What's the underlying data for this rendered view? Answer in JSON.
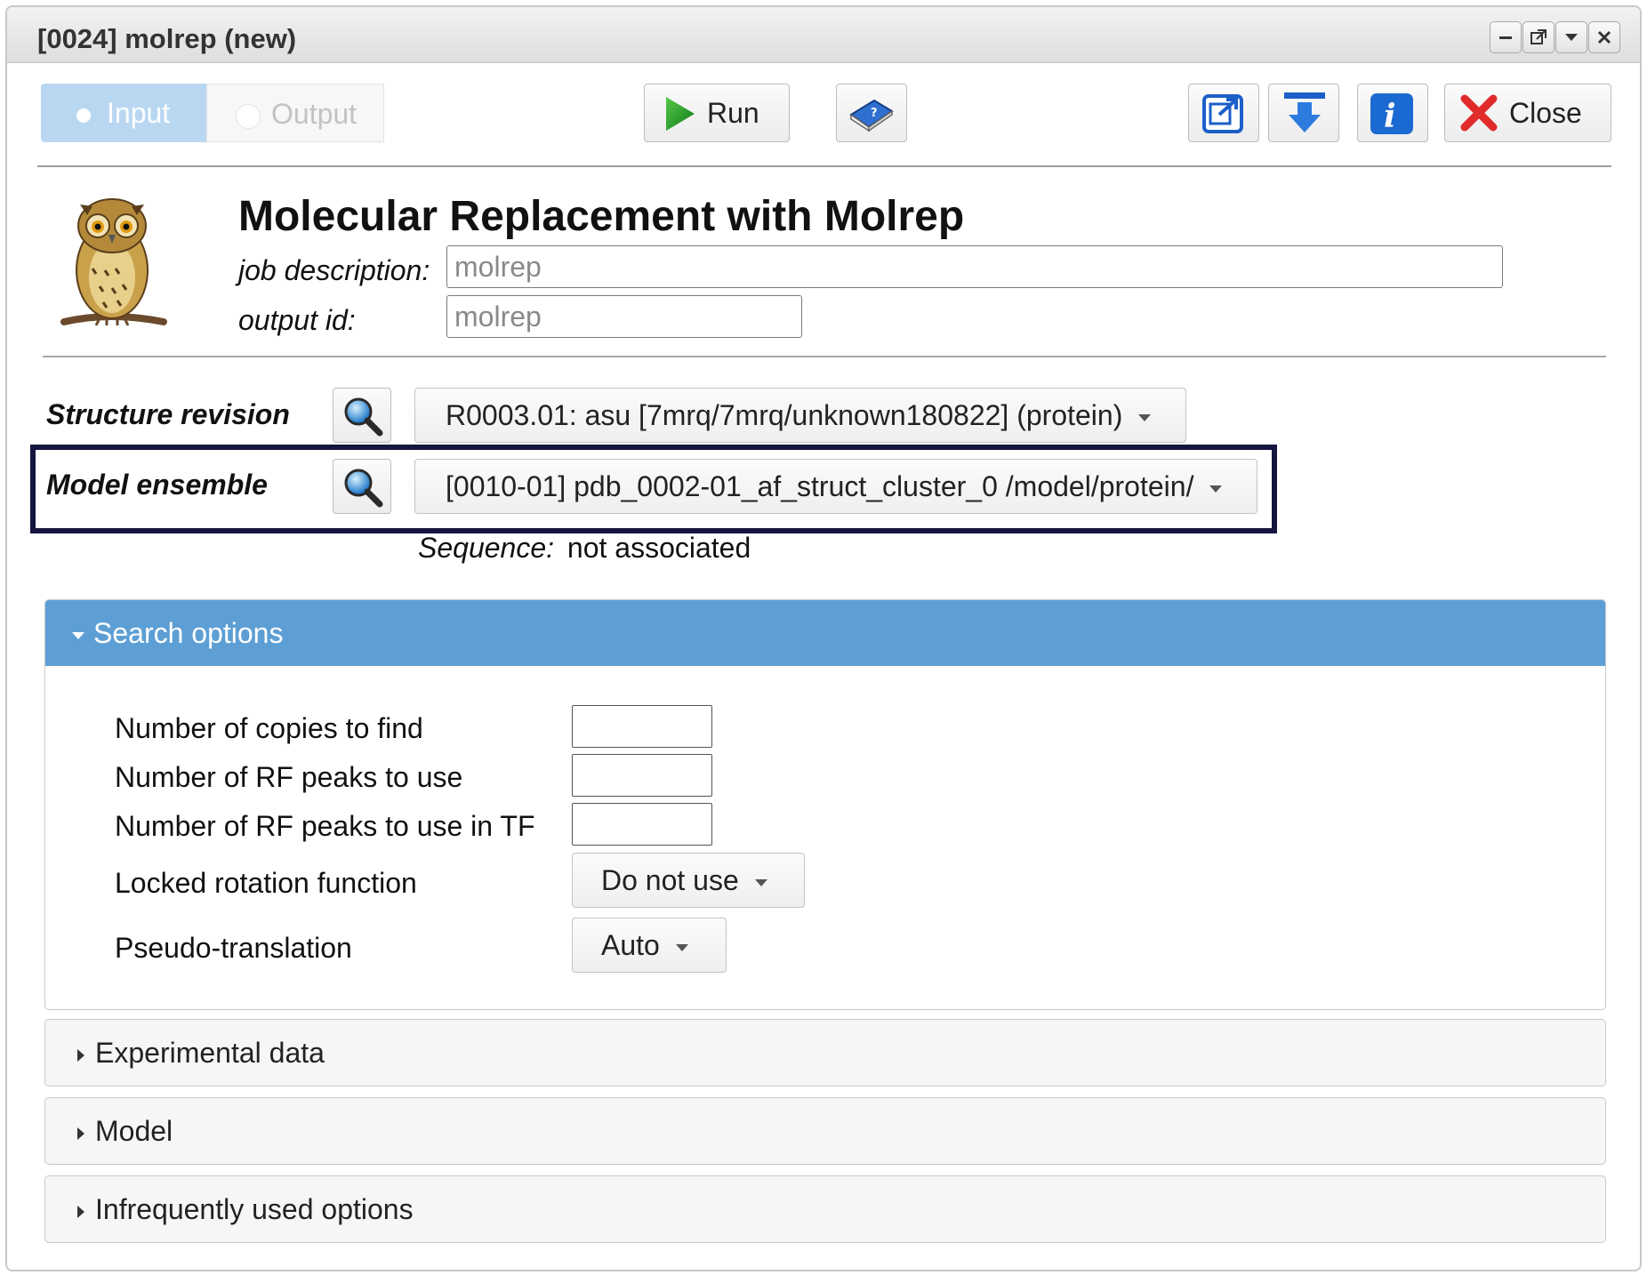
{
  "window": {
    "title": "[0024] molrep (new)",
    "controls": [
      "minimize-icon",
      "popout-icon",
      "collapse-icon",
      "close-icon"
    ]
  },
  "toolbar": {
    "tabs": [
      {
        "label": "Input",
        "selected": true
      },
      {
        "label": "Output",
        "selected": false
      }
    ],
    "run_label": "Run",
    "close_label": "Close",
    "icons": [
      "run-triangle-icon",
      "help-book-icon",
      "export-icon",
      "download-icon",
      "info-icon",
      "close-x-icon"
    ]
  },
  "header": {
    "title": "Molecular Replacement with Molrep",
    "logo": "owl-icon",
    "job_description_label": "job description:",
    "job_description_value": "molrep",
    "output_id_label": "output id:",
    "output_id_value": "molrep"
  },
  "inputs": {
    "structure_revision": {
      "label": "Structure revision",
      "value": "R0003.01: asu [7mrq/7mrq/unknown180822] (protein)"
    },
    "model_ensemble": {
      "label": "Model ensemble",
      "value": "[0010-01] pdb_0002-01_af_struct_cluster_0 /model/protein/"
    },
    "sequence": {
      "label": "Sequence:",
      "value": "not associated"
    }
  },
  "search_options": {
    "title": "Search options",
    "expanded": true,
    "fields": [
      {
        "label": "Number of copies to find",
        "value": ""
      },
      {
        "label": "Number of RF peaks to use",
        "value": ""
      },
      {
        "label": "Number of RF peaks to use in TF",
        "value": ""
      }
    ],
    "locked_rotation_label": "Locked rotation function",
    "locked_rotation_value": "Do not use",
    "pseudo_translation_label": "Pseudo-translation",
    "pseudo_translation_value": "Auto"
  },
  "sections": [
    {
      "title": "Experimental data",
      "expanded": false
    },
    {
      "title": "Model",
      "expanded": false
    },
    {
      "title": "Infrequently used options",
      "expanded": false
    }
  ],
  "colors": {
    "accent": "#5d9fd5",
    "highlight_border": "#151540",
    "input_tab": "#b9d7f1"
  }
}
